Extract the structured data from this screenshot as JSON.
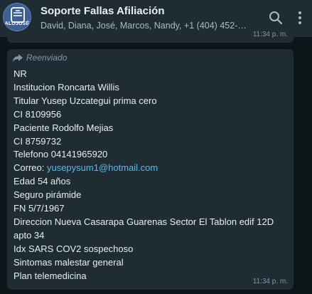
{
  "header": {
    "avatar_text": "ALOJOSÉ",
    "title": "Soporte Fallas Afiliación",
    "subtitle": "David, Diana, José, Marcos, Nandy, +1 (404) 452-…",
    "search_icon": "search-icon",
    "menu_icon": "kebab-menu-icon"
  },
  "previous_message": {
    "time": "11:34 p. m."
  },
  "message": {
    "forwarded_label": "Reenviado",
    "lines": [
      "NR",
      "Institucion Roncarta Willis",
      "Titular Yusep Uzcategui prima cero",
      "CI 8109956",
      "Paciente Rodolfo Mejias",
      "CI 8759732",
      "Telefono 04141965920"
    ],
    "email_label": "Correo: ",
    "email": "yusepysum1@hotmail.com",
    "lines_after": [
      "Edad 54 años",
      "Seguro pirámide",
      "FN 5/7/1967",
      "Direccion Nueva Casarapa Guarenas Sector El Tablon edif 12D",
      "apto 34",
      "Idx SARS COV2 sospechoso",
      "Sintomas malestar general",
      "Plan telemedicina"
    ],
    "time": "11:34 p. m."
  },
  "colors": {
    "header_bg": "#202c33",
    "bubble_bg": "#202c33",
    "chat_bg": "#0e1519",
    "link": "#53bdeb",
    "text": "#e9edef",
    "muted": "#8696a0"
  }
}
